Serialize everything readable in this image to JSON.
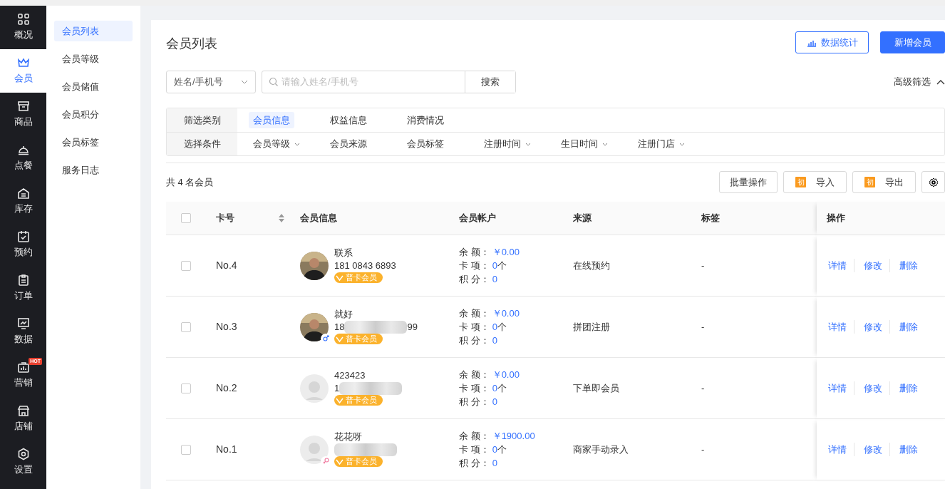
{
  "nav": [
    {
      "label": "概况",
      "selected": false
    },
    {
      "label": "会员",
      "selected": true
    },
    {
      "label": "商品",
      "selected": false
    },
    {
      "label": "点餐",
      "selected": false
    },
    {
      "label": "库存",
      "selected": false
    },
    {
      "label": "预约",
      "selected": false
    },
    {
      "label": "订单",
      "selected": false
    },
    {
      "label": "数据",
      "selected": false
    },
    {
      "label": "营销",
      "selected": false,
      "badge": "HOT"
    },
    {
      "label": "店铺",
      "selected": false
    },
    {
      "label": "设置",
      "selected": false
    }
  ],
  "subnav": [
    {
      "label": "会员列表",
      "selected": true
    },
    {
      "label": "会员等级",
      "selected": false
    },
    {
      "label": "会员储值",
      "selected": false
    },
    {
      "label": "会员积分",
      "selected": false
    },
    {
      "label": "会员标签",
      "selected": false
    },
    {
      "label": "服务日志",
      "selected": false
    }
  ],
  "page_title": "会员列表",
  "header_buttons": [
    {
      "label": "数据统计",
      "kind": "outline"
    },
    {
      "label": "新增会员",
      "kind": "primary"
    }
  ],
  "search": {
    "field_select": "姓名/手机号",
    "placeholder": "请输入姓名/手机号",
    "button": "搜索"
  },
  "advanced_filter": {
    "label": "高级筛选",
    "expanded": true
  },
  "filter_rows": [
    {
      "label": "筛选类别",
      "options": [
        {
          "label": "会员信息",
          "selected": true
        },
        {
          "label": "权益信息",
          "selected": false
        },
        {
          "label": "消费情况",
          "selected": false
        }
      ]
    },
    {
      "label": "选择条件",
      "options": [
        {
          "label": "会员等级",
          "dropdown": true
        },
        {
          "label": "会员来源",
          "dropdown": false
        },
        {
          "label": "会员标签",
          "dropdown": false
        },
        {
          "label": "注册时间",
          "dropdown": true
        },
        {
          "label": "生日时间",
          "dropdown": true
        },
        {
          "label": "注册门店",
          "dropdown": true
        }
      ]
    }
  ],
  "count": "共 4 名会员",
  "toolbar_buttons": [
    {
      "label": "批量操作",
      "kind": "plain"
    },
    {
      "label": "导入",
      "kind": "tagged",
      "tag": "初"
    },
    {
      "label": "导出",
      "kind": "tagged",
      "tag": "初"
    }
  ],
  "table": {
    "select_all": {
      "checked": false
    },
    "columns": [
      "卡号",
      "会员信息",
      "会员帐户",
      "来源",
      "标签",
      "操作"
    ],
    "rows": [
      {
        "checked": false,
        "card_no": "No.4",
        "avatar": {
          "kind": "photo"
        },
        "name": "联系",
        "phone": "181 0843 6893",
        "blurred": false,
        "tier": "普卡会员",
        "balance_label": "余 额：",
        "balance": "￥0.00",
        "cards_label": "卡 项：",
        "cards": "0",
        "cards_unit": "个",
        "points_label": "积 分：",
        "points": "0",
        "source": "在线预约",
        "tags": "-",
        "actions": [
          "详情",
          "修改",
          "删除"
        ]
      },
      {
        "checked": false,
        "card_no": "No.3",
        "avatar": {
          "kind": "photo"
        },
        "sex": {
          "kind": "male"
        },
        "name": "就好",
        "phone": "18",
        "phone_tail": "99",
        "blurred": true,
        "tier": "普卡会员",
        "balance_label": "余 额：",
        "balance": "￥0.00",
        "cards_label": "卡 项：",
        "cards": "0",
        "cards_unit": "个",
        "points_label": "积 分：",
        "points": "0",
        "source": "拼团注册",
        "tags": "-",
        "actions": [
          "详情",
          "修改",
          "删除"
        ]
      },
      {
        "checked": false,
        "card_no": "No.2",
        "avatar": {
          "kind": "default"
        },
        "name": "423423",
        "phone": "1",
        "blurred": true,
        "tier": "普卡会员",
        "balance_label": "余 额：",
        "balance": "￥0.00",
        "cards_label": "卡 项：",
        "cards": "0",
        "cards_unit": "个",
        "points_label": "积 分：",
        "points": "0",
        "source": "下单即会员",
        "tags": "-",
        "actions": [
          "详情",
          "修改",
          "删除"
        ]
      },
      {
        "checked": false,
        "card_no": "No.1",
        "avatar": {
          "kind": "default"
        },
        "sex": {
          "kind": "female"
        },
        "name": "花花呀",
        "blurred": true,
        "tier": "普卡会员",
        "balance_label": "余 额：",
        "balance": "￥1900.00",
        "cards_label": "卡 项：",
        "cards": "0",
        "cards_unit": "个",
        "points_label": "积 分：",
        "points": "0",
        "source": "商家手动录入",
        "tags": "-",
        "actions": [
          "详情",
          "修改",
          "删除"
        ]
      }
    ]
  }
}
